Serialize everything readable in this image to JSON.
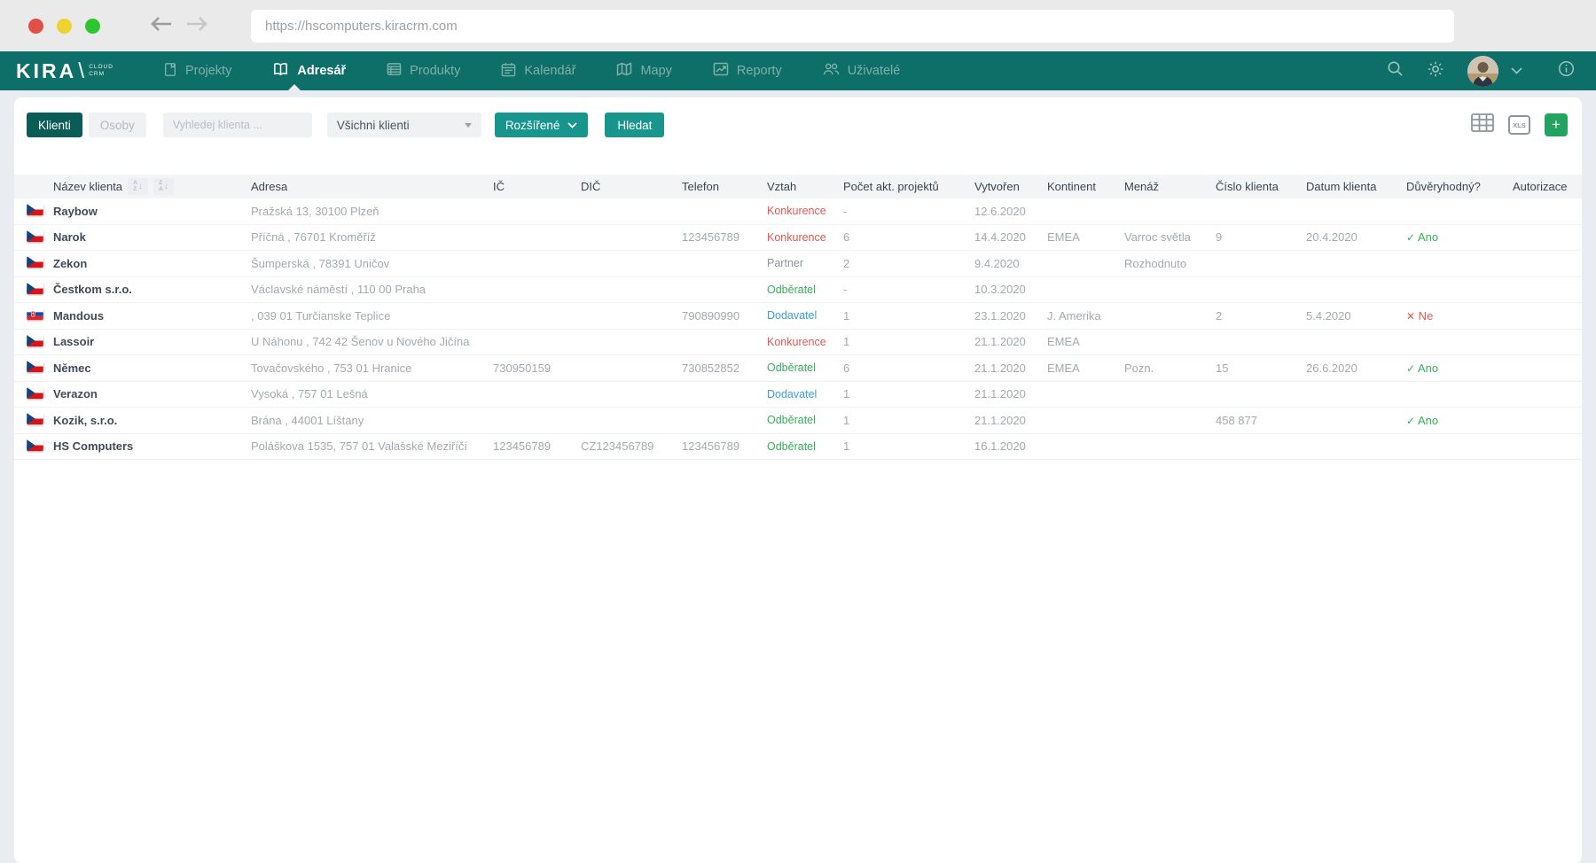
{
  "browser": {
    "url": "https://hscomputers.kiracrm.com"
  },
  "nav": {
    "logo": {
      "brand": "KIRA",
      "sub1": "CLOUD",
      "sub2": "CRM"
    },
    "items": [
      {
        "label": "Projekty",
        "icon": "document-icon",
        "active": false
      },
      {
        "label": "Adresář",
        "icon": "open-book-icon",
        "active": true
      },
      {
        "label": "Produkty",
        "icon": "products-icon",
        "active": false
      },
      {
        "label": "Kalendář",
        "icon": "calendar-icon",
        "active": false
      },
      {
        "label": "Mapy",
        "icon": "map-icon",
        "active": false
      },
      {
        "label": "Reporty",
        "icon": "report-icon",
        "active": false
      },
      {
        "label": "Uživatelé",
        "icon": "users-icon",
        "active": false
      }
    ]
  },
  "toolbar": {
    "klienti_tab": "Klienti",
    "osoby_tab": "Osoby",
    "search_placeholder": "Vyhledej klienta ...",
    "filter_value": "Všichni klienti",
    "advanced_button": "Rozšířené",
    "search_button": "Hledat",
    "add_button": "+"
  },
  "table": {
    "columns": [
      "Název klienta",
      "Adresa",
      "IČ",
      "DIČ",
      "Telefon",
      "Vztah",
      "Počet akt. projektů",
      "Vytvořen",
      "Kontinent",
      "Menáž",
      "Číslo klienta",
      "Datum klienta",
      "Důvěryhodný?",
      "Autorizace"
    ],
    "rows": [
      {
        "flag": "cz",
        "name": "Raybow",
        "address": "Pražská 13, 30100 Plzeň",
        "ic": "",
        "dic": "",
        "telefon": "",
        "vztah": "Konkurence",
        "pocet": "-",
        "vytvoren": "12.6.2020",
        "kontinent": "",
        "menaz": "",
        "cislo": "",
        "datum": "",
        "duveryhodny": "",
        "autorizace": ""
      },
      {
        "flag": "cz",
        "name": "Narok",
        "address": "Příčná , 76701 Kroměříž",
        "ic": "",
        "dic": "",
        "telefon": "123456789",
        "vztah": "Konkurence",
        "pocet": "6",
        "vytvoren": "14.4.2020",
        "kontinent": "EMEA",
        "menaz": "Varroc světla",
        "cislo": "9",
        "datum": "20.4.2020",
        "duveryhodny": "Ano",
        "autorizace": ""
      },
      {
        "flag": "cz",
        "name": "Zekon",
        "address": "Šumperská , 78391 Uničov",
        "ic": "",
        "dic": "",
        "telefon": "",
        "vztah": "Partner",
        "pocet": "2",
        "vytvoren": "9.4.2020",
        "kontinent": "",
        "menaz": "Rozhodnuto",
        "cislo": "",
        "datum": "",
        "duveryhodny": "",
        "autorizace": ""
      },
      {
        "flag": "cz",
        "name": "Čestkom s.r.o.",
        "address": "Václavské náměstí , 110 00 Praha",
        "ic": "",
        "dic": "",
        "telefon": "",
        "vztah": "Odběratel",
        "pocet": "-",
        "vytvoren": "10.3.2020",
        "kontinent": "",
        "menaz": "",
        "cislo": "",
        "datum": "",
        "duveryhodny": "",
        "autorizace": ""
      },
      {
        "flag": "sk",
        "name": "Mandous",
        "address": ", 039 01 Turčianske Teplice",
        "ic": "",
        "dic": "",
        "telefon": "790890990",
        "vztah": "Dodavatel",
        "pocet": "1",
        "vytvoren": "23.1.2020",
        "kontinent": "J. Amerika",
        "menaz": "",
        "cislo": "2",
        "datum": "5.4.2020",
        "duveryhodny": "Ne",
        "autorizace": ""
      },
      {
        "flag": "cz",
        "name": "Lassoir",
        "address": "U Náhonu , 742 42 Šenov u Nového Jičína",
        "ic": "",
        "dic": "",
        "telefon": "",
        "vztah": "Konkurence",
        "pocet": "1",
        "vytvoren": "21.1.2020",
        "kontinent": "EMEA",
        "menaz": "",
        "cislo": "",
        "datum": "",
        "duveryhodny": "",
        "autorizace": ""
      },
      {
        "flag": "cz",
        "name": "Němec",
        "address": "Tovačovského , 753 01 Hranice",
        "ic": "730950159",
        "dic": "",
        "telefon": "730852852",
        "vztah": "Odběratel",
        "pocet": "6",
        "vytvoren": "21.1.2020",
        "kontinent": "EMEA",
        "menaz": "Pozn.",
        "cislo": "15",
        "datum": "26.6.2020",
        "duveryhodny": "Ano",
        "autorizace": ""
      },
      {
        "flag": "cz",
        "name": "Verazon",
        "address": "Vysoká , 757 01 Lešná",
        "ic": "",
        "dic": "",
        "telefon": "",
        "vztah": "Dodavatel",
        "pocet": "1",
        "vytvoren": "21.1.2020",
        "kontinent": "",
        "menaz": "",
        "cislo": "",
        "datum": "",
        "duveryhodny": "",
        "autorizace": ""
      },
      {
        "flag": "cz",
        "name": "Kozik, s.r.o.",
        "address": "Brána , 44001 Líštany",
        "ic": "",
        "dic": "",
        "telefon": "",
        "vztah": "Odběratel",
        "pocet": "1",
        "vytvoren": "21.1.2020",
        "kontinent": "",
        "menaz": "",
        "cislo": "458 877",
        "datum": "",
        "duveryhodny": "Ano",
        "autorizace": ""
      },
      {
        "flag": "cz",
        "name": "HS Computers",
        "address": "Poláškova 1535, 757 01 Valašské Meziříčí",
        "ic": "123456789",
        "dic": "CZ123456789",
        "telefon": "123456789",
        "vztah": "Odběratel",
        "pocet": "1",
        "vytvoren": "16.1.2020",
        "kontinent": "",
        "menaz": "",
        "cislo": "",
        "datum": "",
        "duveryhodny": "",
        "autorizace": ""
      }
    ]
  },
  "colors": {
    "navbar_teal": "#0e6f68",
    "active_tab_teal": "#0a5d56",
    "accent_teal": "#18968d",
    "add_button_green": "#23a262",
    "yes_green": "#35b157",
    "no_red": "#e4584f",
    "relation": {
      "Konkurence": "#e4584f",
      "Partner": "#8e959c",
      "Odběratel": "#35b157",
      "Dodavatel": "#3aa0d8"
    }
  }
}
